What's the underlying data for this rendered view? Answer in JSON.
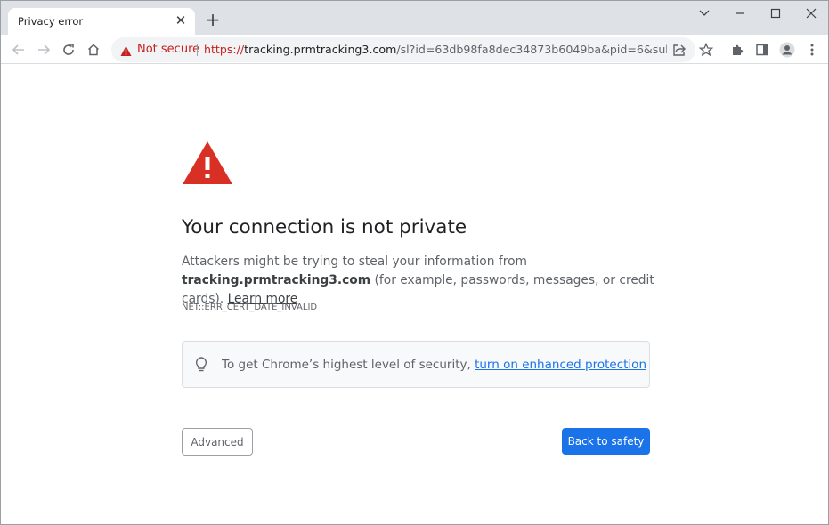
{
  "tab": {
    "title": "Privacy error",
    "close_icon": "close-icon"
  },
  "new_tab_icon": "plus-icon",
  "window_controls": [
    "chevron-down-icon",
    "minimize-icon",
    "maximize-icon",
    "close-icon"
  ],
  "toolbar": {
    "not_secure_label": "Not secure",
    "url_scheme": "https://",
    "url_host": "tracking.prmtracking3.com",
    "url_rest": "/sl?id=63db98fa8dec34873b6049ba&pid=6&sub1=1681874..."
  },
  "content": {
    "heading": "Your connection is not private",
    "desc_prefix": "Attackers might be trying to steal your information from ",
    "desc_host": "tracking.prmtracking3.com",
    "desc_suffix": " (for example, passwords, messages, or credit cards). ",
    "learn_more": "Learn more",
    "error_code": "NET::ERR_CERT_DATE_INVALID",
    "tip_prefix": "To get Chrome’s highest level of security, ",
    "tip_link": "turn on enhanced protection",
    "advanced_label": "Advanced",
    "back_label": "Back to safety"
  },
  "colors": {
    "warning_red": "#d93025",
    "link_blue": "#1a73e8",
    "tabstrip_bg": "#dee1e6"
  }
}
